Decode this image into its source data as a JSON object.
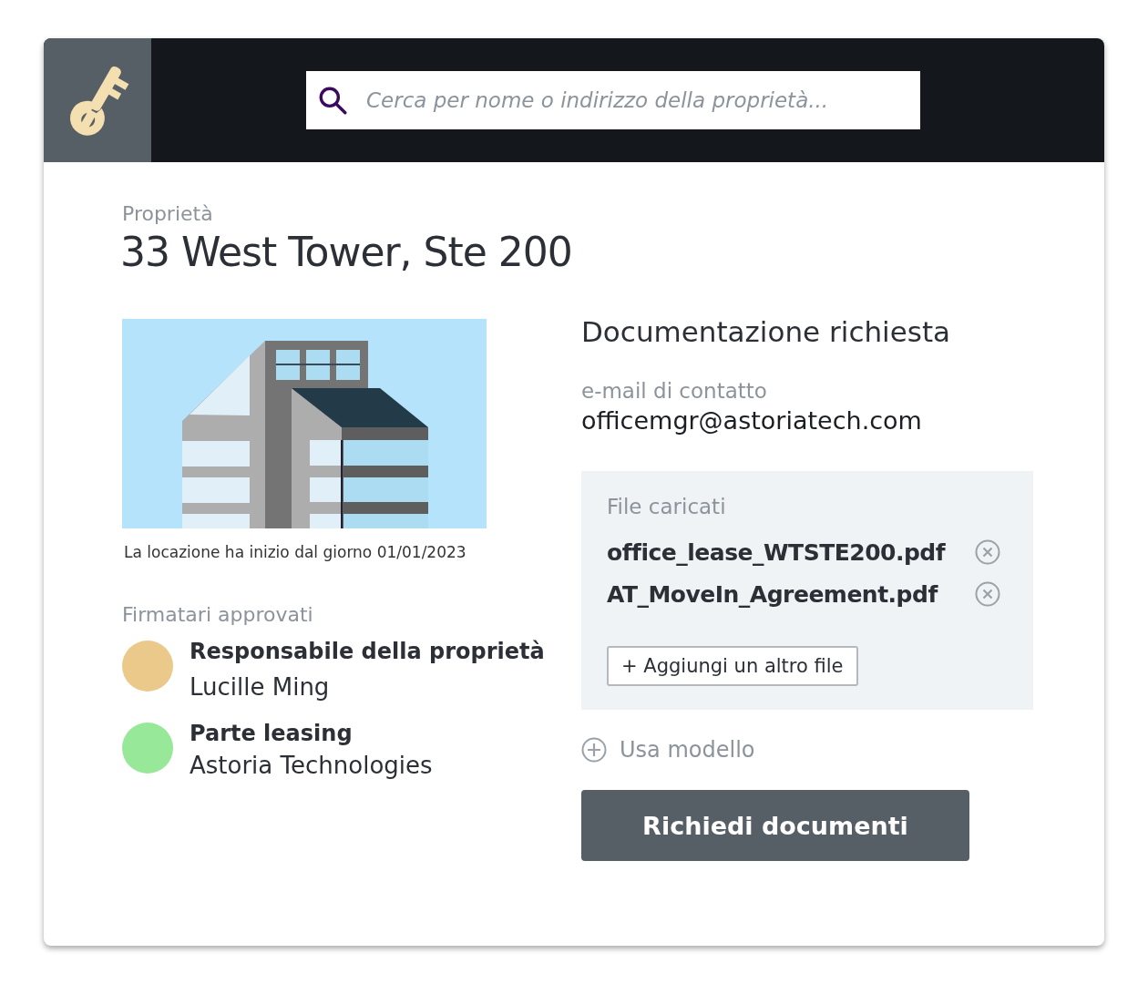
{
  "header": {
    "search": {
      "placeholder": "Cerca per nome o indirizzo della proprietà..."
    }
  },
  "property": {
    "label": "Proprietà",
    "title": "33 West Tower, Ste 200",
    "lease_note": "La locazione ha inizio dal giorno 01/01/2023"
  },
  "signatories": {
    "heading": "Firmatari approvati",
    "items": [
      {
        "role": "Responsabile della proprietà",
        "name": "Lucille Ming",
        "color": "#ebc98a"
      },
      {
        "role": "Parte leasing",
        "name": "Astoria Technologies",
        "color": "#98e89a"
      }
    ]
  },
  "documents": {
    "heading": "Documentazione richiesta",
    "contact_label": "e-mail di contatto",
    "contact_email": "officemgr@astoriatech.com",
    "uploads": {
      "heading": "File caricati",
      "files": [
        "office_lease_WTSTE200.pdf",
        "AT_MoveIn_Agreement.pdf"
      ],
      "add_button": "+ Aggiungi un altro file"
    },
    "template_link": "Usa modello",
    "submit_button": "Richiedi documenti"
  }
}
